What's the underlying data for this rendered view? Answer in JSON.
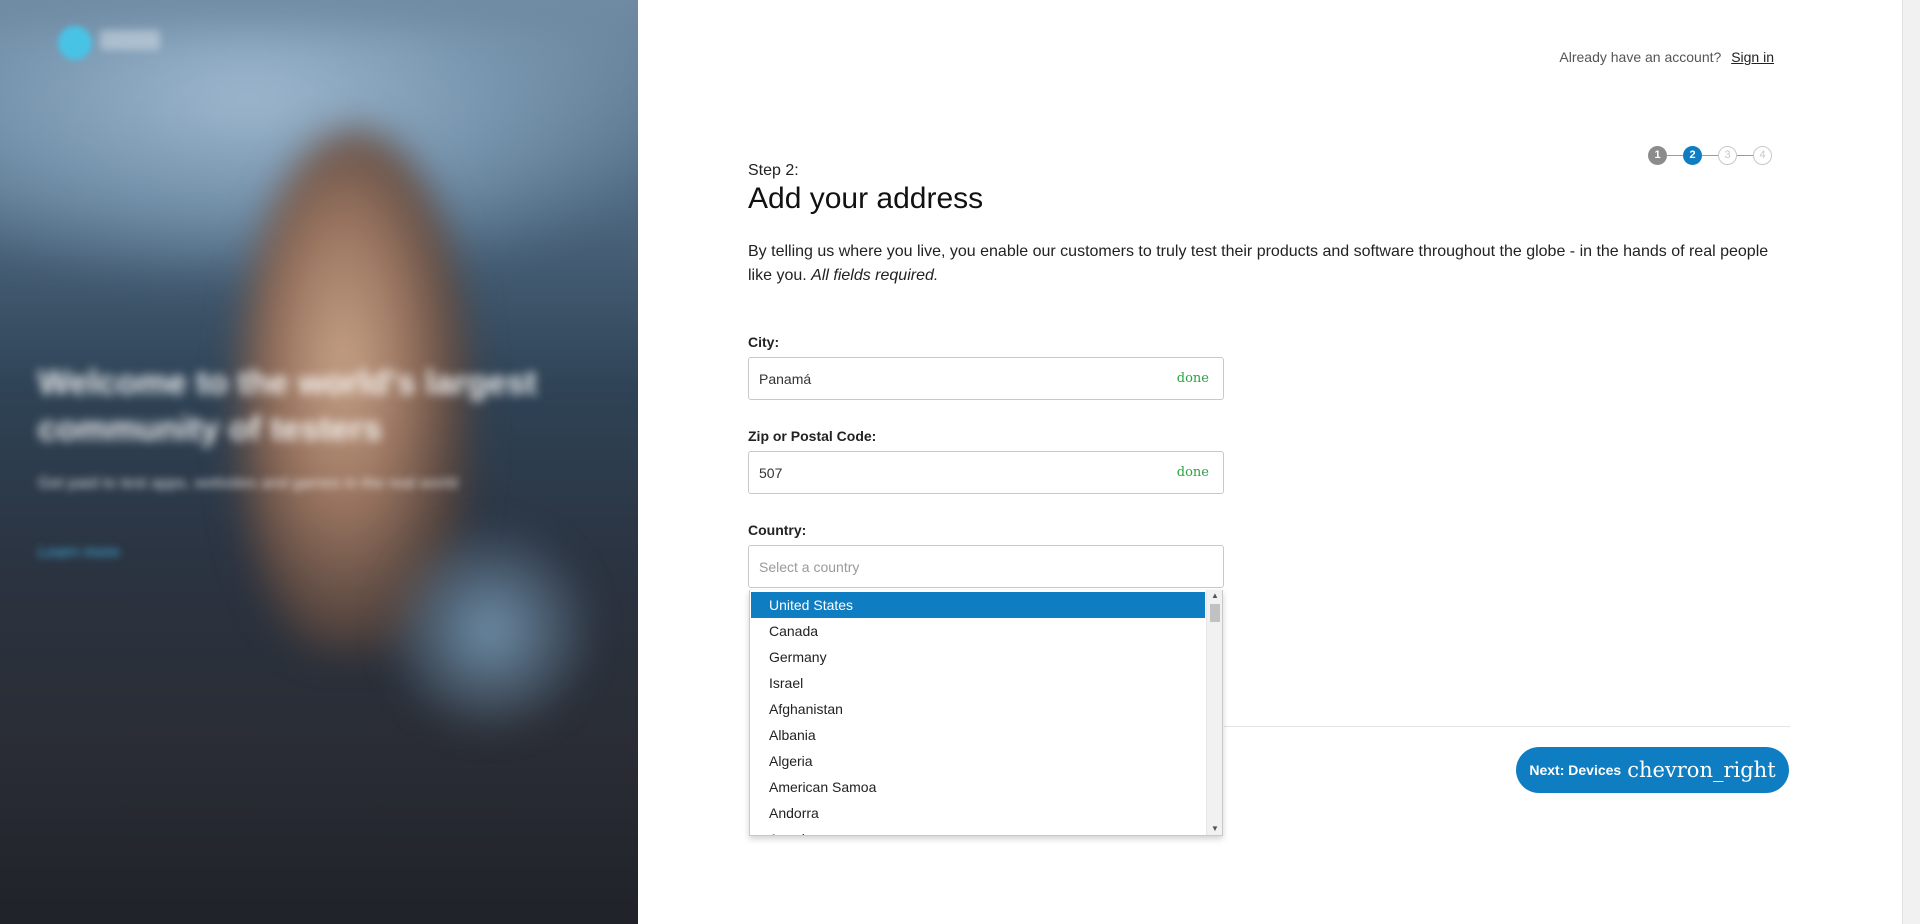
{
  "hero": {
    "headline": "Welcome to the world's largest community of testers",
    "subtitle": "Get paid to test apps, websites and games in the real world",
    "link": "Learn more"
  },
  "topbar": {
    "prompt": "Already have an account?",
    "signin": "Sign in"
  },
  "steps": [
    "1",
    "2",
    "3",
    "4"
  ],
  "form": {
    "step_label": "Step 2:",
    "title": "Add your address",
    "intro": "By telling us where you live, you enable our customers to truly test their products and software throughout the globe - in the hands of real people like you.",
    "required_note": "All fields required.",
    "city": {
      "label": "City:",
      "value": "Panamá",
      "status": "done"
    },
    "zip": {
      "label": "Zip or Postal Code:",
      "value": "507",
      "status": "done"
    },
    "country": {
      "label": "Country:",
      "placeholder": "Select a country"
    }
  },
  "dropdown": {
    "options": [
      "United States",
      "Canada",
      "Germany",
      "Israel",
      "Afghanistan",
      "Albania",
      "Algeria",
      "American Samoa",
      "Andorra",
      "Angola"
    ],
    "selected": "United States",
    "scroll_up": "▲",
    "scroll_down": "▼"
  },
  "next_button": {
    "label": "Next: Devices",
    "icon": "chevron_right"
  },
  "colors": {
    "accent": "#0f7dc2",
    "success": "#2aa340"
  }
}
